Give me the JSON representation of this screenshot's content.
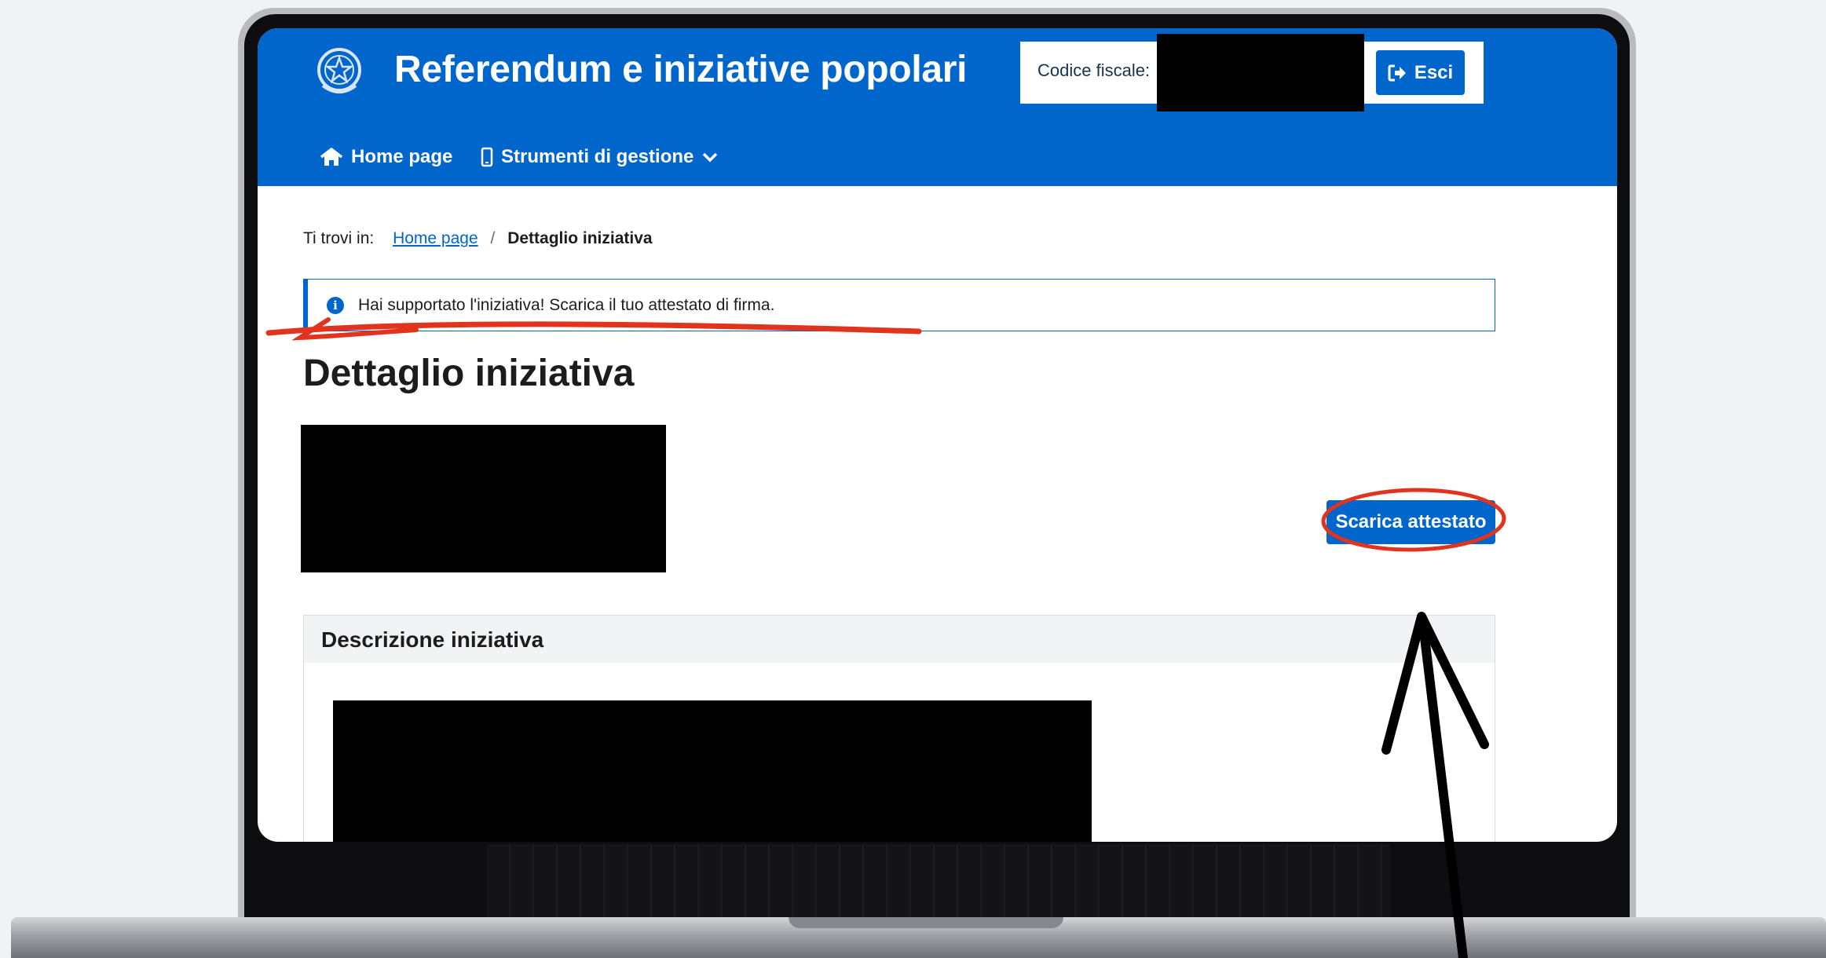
{
  "header": {
    "title": "Referendum e iniziative popolari",
    "fiscal_code_label": "Codice fiscale:",
    "logout_label": "Esci",
    "emblem_icon": "italian-republic-emblem",
    "logout_icon": "sign-out-icon"
  },
  "nav": {
    "items": [
      {
        "label": "Home page",
        "icon": "home-icon"
      },
      {
        "label": "Strumenti di gestione",
        "icon": "mobile-icon",
        "dropdown_icon": "chevron-down-icon"
      }
    ]
  },
  "breadcrumb": {
    "prefix": "Ti trovi in:",
    "home": "Home page",
    "separator": "/",
    "current": "Dettaglio iniziativa"
  },
  "alert": {
    "icon": "info-icon",
    "text": "Hai supportato l'iniziativa! Scarica il tuo attestato di firma."
  },
  "main": {
    "title": "Dettaglio iniziativa",
    "download_button": "Scarica attestato",
    "description_title": "Descrizione iniziativa"
  },
  "colors": {
    "primary": "#0066cc",
    "annotation_red": "#e1341e",
    "annotation_black": "#000000"
  }
}
